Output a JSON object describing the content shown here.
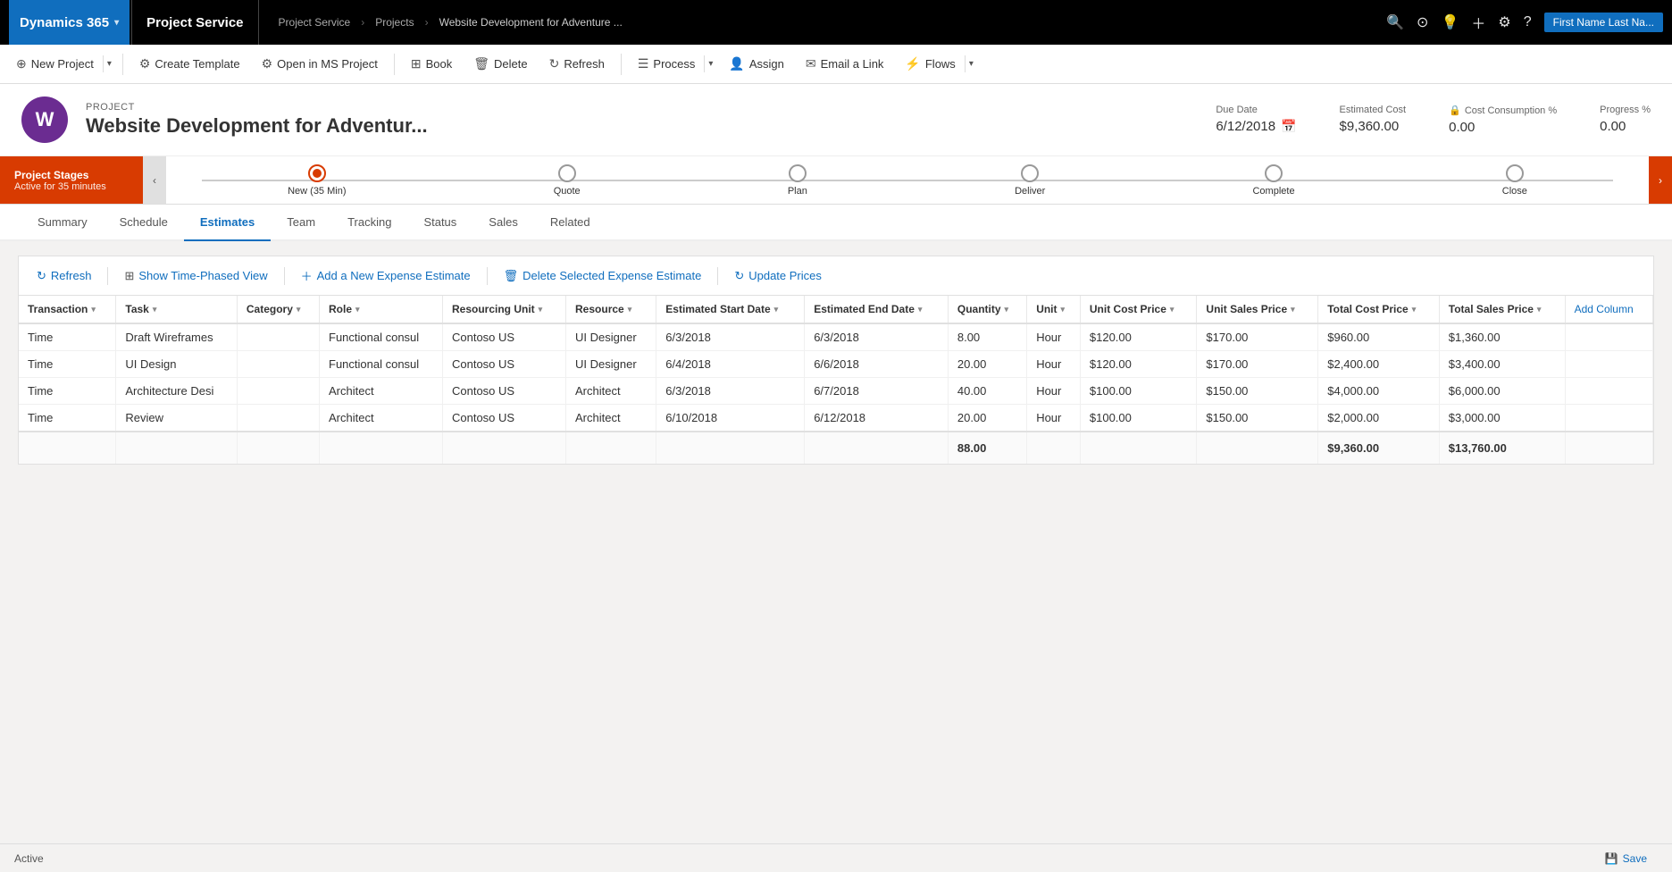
{
  "topNav": {
    "dynamics365": "Dynamics 365",
    "projectService": "Project Service",
    "breadcrumb": [
      "Project Service",
      "Projects",
      "Website Development for Adventure ..."
    ],
    "userLabel": "First Name Last Na...",
    "icons": [
      "search",
      "dashboard",
      "lightbulb",
      "plus",
      "settings",
      "help"
    ]
  },
  "commandBar": {
    "buttons": [
      {
        "id": "new-project",
        "label": "New Project",
        "icon": "⊕",
        "hasSplit": true
      },
      {
        "id": "create-template",
        "label": "Create Template",
        "icon": "📋",
        "hasSplit": false
      },
      {
        "id": "open-ms-project",
        "label": "Open in MS Project",
        "icon": "📁",
        "hasSplit": false
      },
      {
        "id": "book",
        "label": "Book",
        "icon": "🗓",
        "hasSplit": false
      },
      {
        "id": "delete",
        "label": "Delete",
        "icon": "🗑",
        "hasSplit": false
      },
      {
        "id": "refresh",
        "label": "Refresh",
        "icon": "↻",
        "hasSplit": false
      },
      {
        "id": "process",
        "label": "Process",
        "icon": "",
        "hasSplit": true
      },
      {
        "id": "assign",
        "label": "Assign",
        "icon": "👤",
        "hasSplit": false
      },
      {
        "id": "email-link",
        "label": "Email a Link",
        "icon": "✉",
        "hasSplit": false
      },
      {
        "id": "flows",
        "label": "Flows",
        "icon": "",
        "hasSplit": true
      }
    ]
  },
  "projectHeader": {
    "label": "PROJECT",
    "name": "Website Development for Adventur...",
    "avatarLetter": "W",
    "avatarColor": "#6b2c91",
    "dueDate": {
      "label": "Due Date",
      "value": "6/12/2018"
    },
    "estimatedCost": {
      "label": "Estimated Cost",
      "value": "$9,360.00"
    },
    "costConsumption": {
      "label": "Cost Consumption %",
      "value": "0.00"
    },
    "progress": {
      "label": "Progress %",
      "value": "0.00"
    }
  },
  "projectStages": {
    "label": "Project Stages",
    "sublabel": "Active for 35 minutes",
    "stages": [
      {
        "name": "New  (35 Min)",
        "active": true
      },
      {
        "name": "Quote",
        "active": false
      },
      {
        "name": "Plan",
        "active": false
      },
      {
        "name": "Deliver",
        "active": false
      },
      {
        "name": "Complete",
        "active": false
      },
      {
        "name": "Close",
        "active": false
      }
    ]
  },
  "tabs": {
    "items": [
      "Summary",
      "Schedule",
      "Estimates",
      "Team",
      "Tracking",
      "Status",
      "Sales",
      "Related"
    ],
    "active": "Estimates"
  },
  "estimatesToolbar": {
    "refresh": "Refresh",
    "showTimePhasedView": "Show Time-Phased View",
    "addNewExpenseEstimate": "Add a New Expense Estimate",
    "deleteSelectedExpenseEstimate": "Delete Selected Expense Estimate",
    "updatePrices": "Update Prices"
  },
  "table": {
    "columns": [
      {
        "id": "transaction",
        "label": "Transaction",
        "sortable": true
      },
      {
        "id": "task",
        "label": "Task",
        "sortable": true
      },
      {
        "id": "category",
        "label": "Category",
        "sortable": true
      },
      {
        "id": "role",
        "label": "Role",
        "sortable": true
      },
      {
        "id": "resourcingUnit",
        "label": "Resourcing Unit",
        "sortable": true
      },
      {
        "id": "resource",
        "label": "Resource",
        "sortable": true
      },
      {
        "id": "estimatedStartDate",
        "label": "Estimated Start Date",
        "sortable": true
      },
      {
        "id": "estimatedEndDate",
        "label": "Estimated End Date",
        "sortable": true
      },
      {
        "id": "quantity",
        "label": "Quantity",
        "sortable": true
      },
      {
        "id": "unit",
        "label": "Unit",
        "sortable": true
      },
      {
        "id": "unitCostPrice",
        "label": "Unit Cost Price",
        "sortable": true
      },
      {
        "id": "unitSalesPrice",
        "label": "Unit Sales Price",
        "sortable": true
      },
      {
        "id": "totalCostPrice",
        "label": "Total Cost Price",
        "sortable": true
      },
      {
        "id": "totalSalesPrice",
        "label": "Total Sales Price",
        "sortable": true
      },
      {
        "id": "addColumn",
        "label": "Add Column",
        "sortable": false
      }
    ],
    "rows": [
      {
        "transaction": "Time",
        "task": "Draft Wireframes",
        "category": "",
        "role": "Functional consul",
        "resourcingUnit": "Contoso US",
        "resource": "UI Designer",
        "estimatedStartDate": "6/3/2018",
        "estimatedEndDate": "6/3/2018",
        "quantity": "8.00",
        "unit": "Hour",
        "unitCostPrice": "$120.00",
        "unitSalesPrice": "$170.00",
        "totalCostPrice": "$960.00",
        "totalSalesPrice": "$1,360.00"
      },
      {
        "transaction": "Time",
        "task": "UI Design",
        "category": "",
        "role": "Functional consul",
        "resourcingUnit": "Contoso US",
        "resource": "UI Designer",
        "estimatedStartDate": "6/4/2018",
        "estimatedEndDate": "6/6/2018",
        "quantity": "20.00",
        "unit": "Hour",
        "unitCostPrice": "$120.00",
        "unitSalesPrice": "$170.00",
        "totalCostPrice": "$2,400.00",
        "totalSalesPrice": "$3,400.00"
      },
      {
        "transaction": "Time",
        "task": "Architecture Desi",
        "category": "",
        "role": "Architect",
        "resourcingUnit": "Contoso US",
        "resource": "Architect",
        "estimatedStartDate": "6/3/2018",
        "estimatedEndDate": "6/7/2018",
        "quantity": "40.00",
        "unit": "Hour",
        "unitCostPrice": "$100.00",
        "unitSalesPrice": "$150.00",
        "totalCostPrice": "$4,000.00",
        "totalSalesPrice": "$6,000.00"
      },
      {
        "transaction": "Time",
        "task": "Review",
        "category": "",
        "role": "Architect",
        "resourcingUnit": "Contoso US",
        "resource": "Architect",
        "estimatedStartDate": "6/10/2018",
        "estimatedEndDate": "6/12/2018",
        "quantity": "20.00",
        "unit": "Hour",
        "unitCostPrice": "$100.00",
        "unitSalesPrice": "$150.00",
        "totalCostPrice": "$2,000.00",
        "totalSalesPrice": "$3,000.00"
      }
    ],
    "totals": {
      "quantity": "88.00",
      "totalCostPrice": "$9,360.00",
      "totalSalesPrice": "$13,760.00"
    }
  },
  "statusBar": {
    "status": "Active",
    "saveLabel": "Save"
  }
}
